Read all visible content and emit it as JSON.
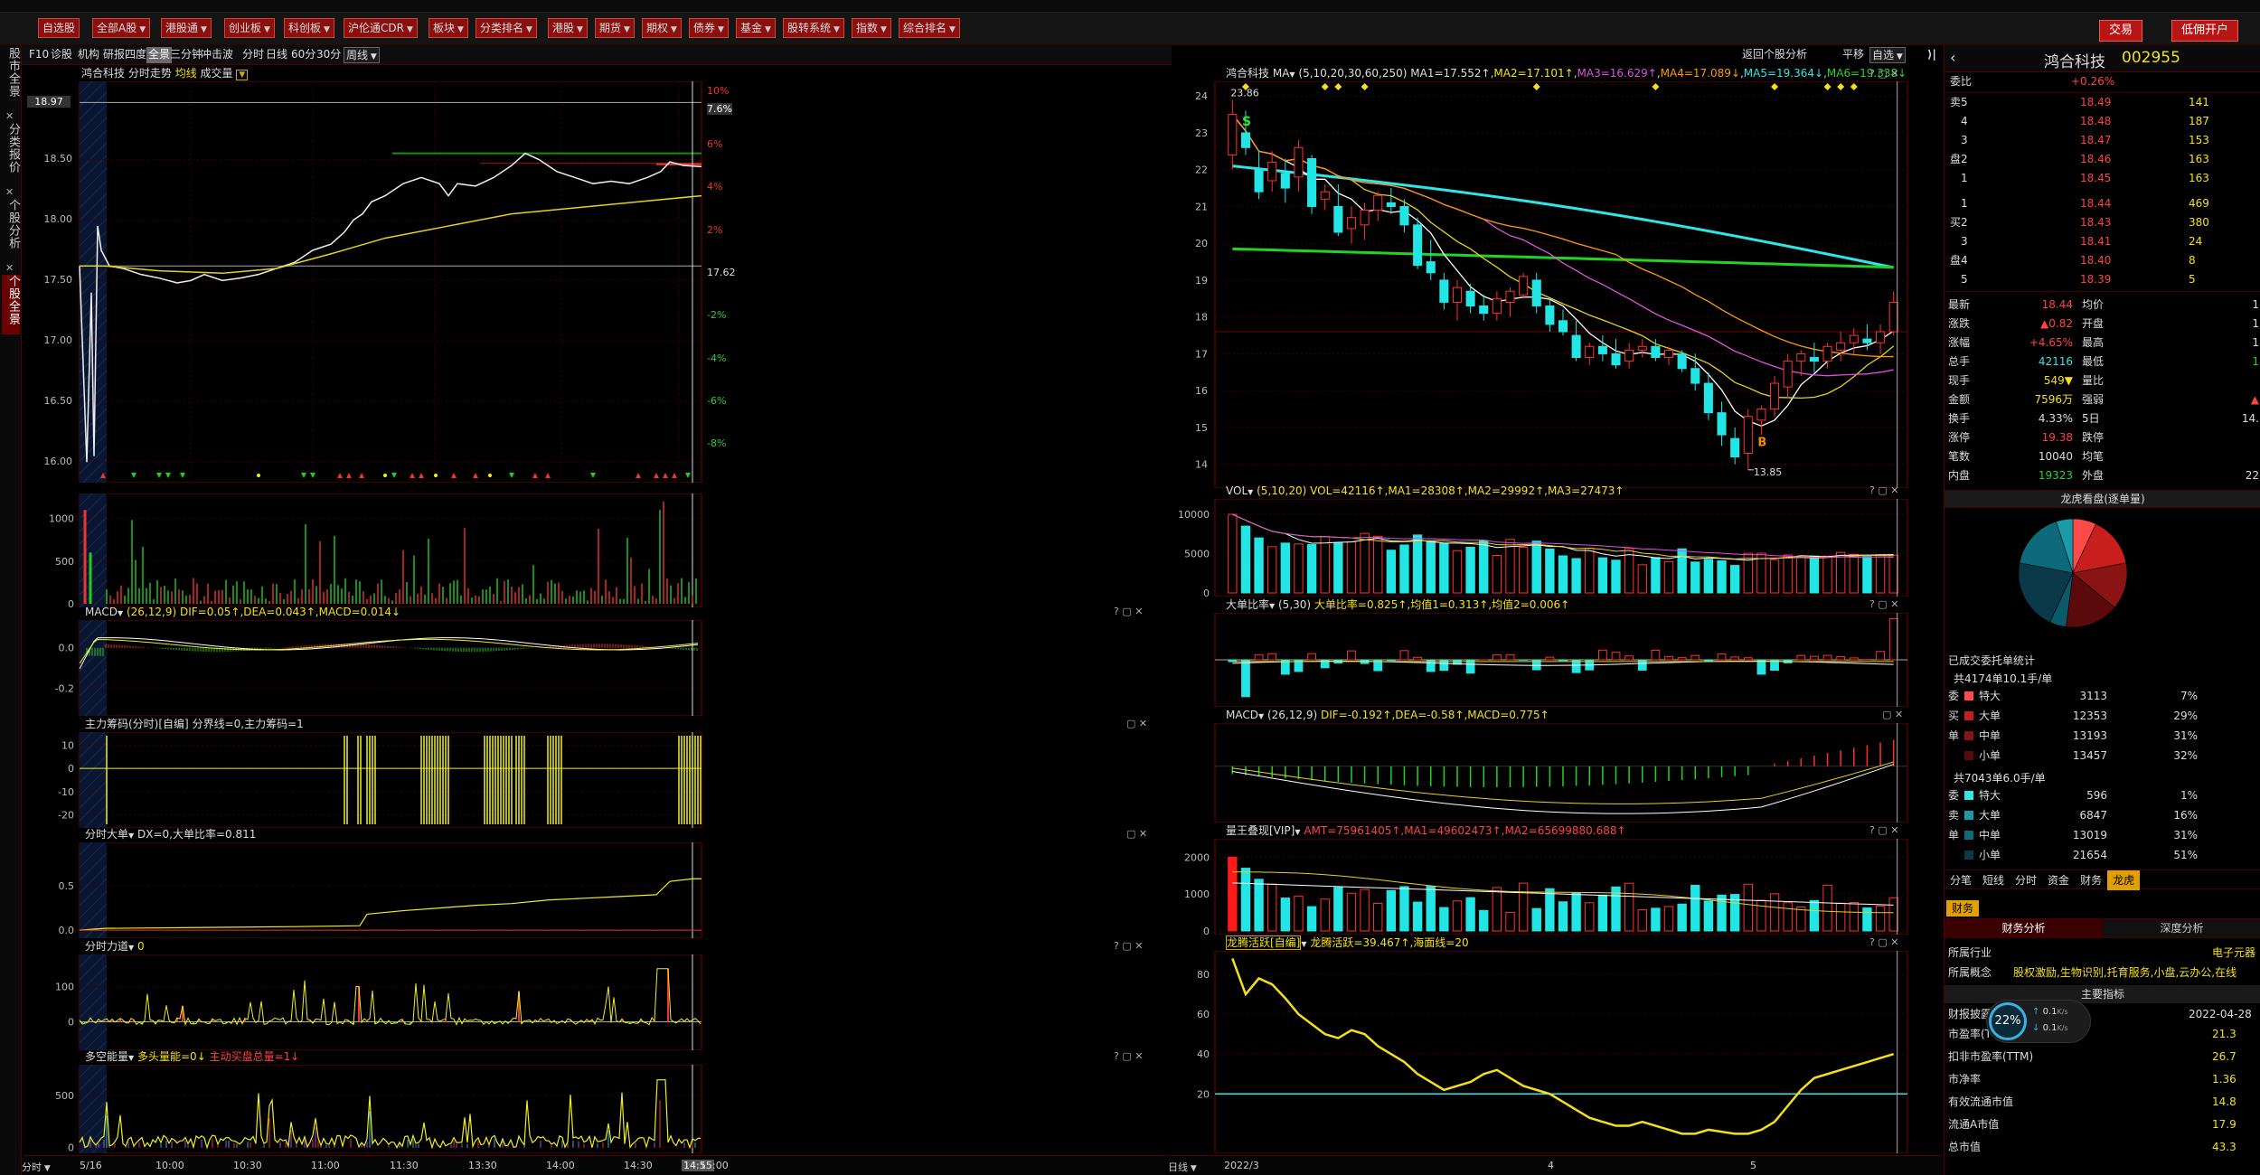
{
  "menu": {
    "items": [
      "自选股",
      "全部A股",
      "港股通",
      "创业板",
      "科创板",
      "沪伦通CDR",
      "板块",
      "分类排名",
      "港股",
      "期货",
      "期权",
      "债券",
      "基金",
      "股转系统",
      "指数",
      "综合排名"
    ],
    "trade": "交易",
    "open_account": "低佣开户"
  },
  "sidebar": [
    "股市全景",
    "分类报价",
    "个股分析",
    "个股全景"
  ],
  "toolbar": {
    "items": [
      "F10",
      "诊股",
      "机构",
      "研报",
      "四度",
      "全景",
      "三分钟",
      "冲击波",
      "分时",
      "日线",
      "60分",
      "30分",
      "周线"
    ],
    "selected": "全景",
    "right": [
      "返回个股分析",
      "平移",
      "自选",
      "✕"
    ]
  },
  "intraday": {
    "title": "鸿合科技",
    "subtitle": "分时走势",
    "mode": "均线",
    "volume": "成交量",
    "price_labels": [
      "18.97",
      "18.50",
      "18.00",
      "17.50",
      "17.00",
      "16.50",
      "16.00"
    ],
    "pct_labels": [
      "10%",
      "7.6%",
      "6%",
      "4%",
      "2%",
      "17.62",
      "-2%",
      "-4%",
      "-6%",
      "-8%"
    ],
    "times": [
      "5/16",
      "10:00",
      "10:30",
      "11:00",
      "11:30",
      "13:30",
      "14:00",
      "14:30",
      "14:55",
      "15:00"
    ],
    "vol_labels": [
      "1000",
      "500",
      "0"
    ],
    "macd_title": "MACD",
    "macd_params": "(26,12,9)",
    "macd_vals": "DIF=0.05↑,DEA=0.043↑,MACD=0.014↓",
    "macd_labels": [
      "0.0",
      "-0.2"
    ],
    "zl_title": "主力筹码(分时)[自编]",
    "zl_vals": "分界线=0,主力筹码=1",
    "zl_labels": [
      "10",
      "0",
      "-10",
      "-20"
    ],
    "dd_title": "分时大单",
    "dd_vals": "DX=0,大单比率=0.811",
    "dd_labels": [
      "0.5",
      "0.0"
    ],
    "ld_title": "分时力道",
    "ld_vals": "0",
    "ld_labels": [
      "100",
      "0"
    ],
    "dk_title": "多空能量",
    "dk_vals": "多头量能=0↓",
    "dk_vals2": "主动买盘总量=1↓",
    "dk_labels": [
      "500",
      "0"
    ],
    "bottom_left": "分时"
  },
  "kline": {
    "title": "鸿合科技",
    "ma": "MA",
    "params": "(5,10,20,30,60,250)",
    "ma1": "MA1=17.552↑",
    "ma2": "MA2=17.101↑",
    "ma3": "MA3=16.629↑",
    "ma4": "MA4=17.089↓",
    "ma5": "MA5=19.364↓",
    "ma6": "MA6=19.338↓",
    "high": "23.86",
    "low": "13.85",
    "y_labels": [
      "24",
      "23",
      "22",
      "21",
      "20",
      "19",
      "18",
      "17",
      "16",
      "15",
      "14"
    ],
    "vol_title": "VOL",
    "vol_params": "(5,10,20)",
    "vol_vals": "VOL=42116↑,MA1=28308↑,MA2=29992↑,MA3=27473↑",
    "vol_labels": [
      "10000",
      "5000",
      "0"
    ],
    "dd_title": "大单比率",
    "dd_params": "(5,30)",
    "dd_vals": "大单比率=0.825↑,均值1=0.313↑,均值2=0.006↑",
    "macd_title": "MACD",
    "macd_params": "(26,12,9)",
    "macd_vals": "DIF=-0.192↑,DEA=-0.58↑,MACD=0.775↑",
    "lw_title": "量王叠现[VIP]",
    "lw_vals": "AMT=75961405↑,MA1=49602473↑,MA2=65699880.688↑",
    "lw_labels": [
      "2000",
      "1000",
      "0"
    ],
    "lt_title": "龙腾活跃[自编]",
    "lt_vals": "龙腾活跃=39.467↑,海面线=20",
    "lt_labels": [
      "80",
      "60",
      "40",
      "20"
    ],
    "dates": [
      "2022/3",
      "4",
      "5"
    ],
    "bottom_left": "日线",
    "buy_mark": "B",
    "sell_mark": "S",
    "candles": [
      [
        22.4,
        23.9,
        22.0,
        23.5
      ],
      [
        23.0,
        23.6,
        22.4,
        22.6
      ],
      [
        22.0,
        22.5,
        21.2,
        21.4
      ],
      [
        21.7,
        22.5,
        21.4,
        22.2
      ],
      [
        21.9,
        22.3,
        21.1,
        21.5
      ],
      [
        21.8,
        22.8,
        21.4,
        22.6
      ],
      [
        22.3,
        22.4,
        20.8,
        21.0
      ],
      [
        21.2,
        21.6,
        20.9,
        21.4
      ],
      [
        21.0,
        21.6,
        20.2,
        20.3
      ],
      [
        20.4,
        21.0,
        20.0,
        20.7
      ],
      [
        20.5,
        21.1,
        20.1,
        20.9
      ],
      [
        20.9,
        21.4,
        20.6,
        21.3
      ],
      [
        21.1,
        21.5,
        20.8,
        21.0
      ],
      [
        21.0,
        21.2,
        20.3,
        20.5
      ],
      [
        20.5,
        20.7,
        19.3,
        19.4
      ],
      [
        19.5,
        20.1,
        19.0,
        19.2
      ],
      [
        19.0,
        19.2,
        18.2,
        18.4
      ],
      [
        18.4,
        19.0,
        17.9,
        18.8
      ],
      [
        18.7,
        18.9,
        18.1,
        18.3
      ],
      [
        18.3,
        18.6,
        17.9,
        18.1
      ],
      [
        18.1,
        18.7,
        17.9,
        18.5
      ],
      [
        18.4,
        18.8,
        18.0,
        18.7
      ],
      [
        18.6,
        19.2,
        18.5,
        19.1
      ],
      [
        19.0,
        19.2,
        18.1,
        18.3
      ],
      [
        18.3,
        18.5,
        17.6,
        17.8
      ],
      [
        17.9,
        18.2,
        17.5,
        17.6
      ],
      [
        17.5,
        17.9,
        16.8,
        16.9
      ],
      [
        16.9,
        17.3,
        16.7,
        17.2
      ],
      [
        17.2,
        17.5,
        16.8,
        17.0
      ],
      [
        17.0,
        17.4,
        16.6,
        16.7
      ],
      [
        16.8,
        17.3,
        16.6,
        17.1
      ],
      [
        17.1,
        17.4,
        16.9,
        17.2
      ],
      [
        17.2,
        17.4,
        16.8,
        16.9
      ],
      [
        16.9,
        17.2,
        16.7,
        17.1
      ],
      [
        17.0,
        17.1,
        16.5,
        16.6
      ],
      [
        16.6,
        17.0,
        16.0,
        16.2
      ],
      [
        16.2,
        16.5,
        15.2,
        15.4
      ],
      [
        15.4,
        15.7,
        14.5,
        14.8
      ],
      [
        14.7,
        15.0,
        14.0,
        14.2
      ],
      [
        14.3,
        15.5,
        13.85,
        15.3
      ],
      [
        15.2,
        15.6,
        14.8,
        15.5
      ],
      [
        15.5,
        16.4,
        15.3,
        16.2
      ],
      [
        16.1,
        17.0,
        15.8,
        16.8
      ],
      [
        16.8,
        17.1,
        16.4,
        17.0
      ],
      [
        16.9,
        17.3,
        16.5,
        16.8
      ],
      [
        16.8,
        17.3,
        16.6,
        17.2
      ],
      [
        17.1,
        17.6,
        16.8,
        17.3
      ],
      [
        17.3,
        17.7,
        17.0,
        17.5
      ],
      [
        17.4,
        17.8,
        17.1,
        17.3
      ],
      [
        17.3,
        17.8,
        17.0,
        17.6
      ],
      [
        17.6,
        18.7,
        17.5,
        18.4
      ]
    ]
  },
  "quote": {
    "name": "鸿合科技",
    "code": "002955",
    "weibi_label": "委比",
    "weibi": "+0.26%",
    "sell": [
      [
        "卖",
        "5",
        "18.49",
        "141"
      ],
      [
        "",
        "4",
        "18.48",
        "187"
      ],
      [
        "",
        "3",
        "18.47",
        "153"
      ],
      [
        "盘",
        "2",
        "18.46",
        "163"
      ],
      [
        "",
        "1",
        "18.45",
        "163"
      ]
    ],
    "buy": [
      [
        "",
        "1",
        "18.44",
        "469"
      ],
      [
        "买",
        "2",
        "18.43",
        "380"
      ],
      [
        "",
        "3",
        "18.41",
        "24"
      ],
      [
        "盘",
        "4",
        "18.40",
        "8"
      ],
      [
        "",
        "5",
        "18.39",
        "5"
      ]
    ],
    "stats": [
      [
        "最新",
        "18.44",
        "均价",
        "1"
      ],
      [
        "涨跌",
        "▲0.82",
        "开盘",
        "1"
      ],
      [
        "涨幅",
        "+4.65%",
        "最高",
        "1"
      ],
      [
        "总手",
        "42116",
        "最低",
        "1"
      ],
      [
        "现手",
        "549▼",
        "量比",
        ""
      ],
      [
        "金额",
        "7596万",
        "强弱",
        "▲"
      ],
      [
        "换手",
        "4.33%",
        "5日",
        "14."
      ],
      [
        "涨停",
        "19.38",
        "跌停",
        ""
      ],
      [
        "笔数",
        "10040",
        "均笔",
        ""
      ],
      [
        "内盘",
        "19323",
        "外盘",
        "22"
      ]
    ],
    "lh_title": "龙虎看盘(逐单量)",
    "lh_stat_title": "已成交委托单统计",
    "sell_total": "共4174单10.1手/单",
    "sell_rows": [
      [
        "特大",
        "3113",
        "7%"
      ],
      [
        "大单",
        "12353",
        "29%"
      ],
      [
        "中单",
        "13193",
        "31%"
      ],
      [
        "小单",
        "13457",
        "32%"
      ]
    ],
    "sell_side": [
      "委",
      "买",
      "单"
    ],
    "buy_total": "共7043单6.0手/单",
    "buy_rows": [
      [
        "特大",
        "596",
        "1%"
      ],
      [
        "大单",
        "6847",
        "16%"
      ],
      [
        "中单",
        "13019",
        "31%"
      ],
      [
        "小单",
        "21654",
        "51%"
      ]
    ],
    "buy_side": [
      "委",
      "卖",
      "单"
    ],
    "tabs": [
      "分笔",
      "短线",
      "分时",
      "资金",
      "财务",
      "龙虎"
    ],
    "tab_active": "龙虎",
    "fin_tab": "财务",
    "fin_sub": [
      "财务分析",
      "深度分析"
    ],
    "industry_label": "所属行业",
    "industry": "电子元器",
    "concept_label": "所属概念",
    "concept": "股权激励,生物识别,托育服务,小盘,云办公,在线",
    "main_indicator": "主要指标",
    "report_label": "财报披露",
    "report_date": "2022-04-28",
    "fin_rows": [
      [
        "市盈率(TTM)",
        "21.3"
      ],
      [
        "扣非市盈率(TTM)",
        "26.7"
      ],
      [
        "市净率",
        "1.36"
      ],
      [
        "有效流通市值",
        "14.8"
      ],
      [
        "流通A市值",
        "17.9"
      ],
      [
        "总市值",
        "43.3"
      ]
    ],
    "net_pct": "22%",
    "net_up": "0.1",
    "net_down": "0.1",
    "net_unit": "K/s"
  }
}
